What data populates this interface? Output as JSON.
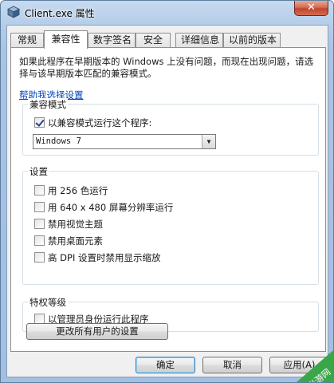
{
  "window": {
    "title": "Client.exe 属性",
    "close_label": "✕"
  },
  "tabs": [
    {
      "label": "常规"
    },
    {
      "label": "兼容性"
    },
    {
      "label": "数字签名"
    },
    {
      "label": "安全"
    },
    {
      "label": "详细信息"
    },
    {
      "label": "以前的版本"
    }
  ],
  "active_tab": "兼容性",
  "intro_text": "如果此程序在早期版本的 Windows 上没有问题，而现在出现问题，请选择与该早期版本匹配的兼容模式。",
  "help_link": "帮助我选择设置",
  "compat_mode": {
    "title": "兼容模式",
    "checkbox_label": "以兼容模式运行这个程序:",
    "checked": true,
    "selected_os": "Windows 7"
  },
  "settings": {
    "title": "设置",
    "options": [
      {
        "label": "用 256 色运行",
        "checked": false
      },
      {
        "label": "用 640 x 480 屏幕分辨率运行",
        "checked": false
      },
      {
        "label": "禁用视觉主题",
        "checked": false
      },
      {
        "label": "禁用桌面元素",
        "checked": false
      },
      {
        "label": "高 DPI 设置时禁用显示缩放",
        "checked": false
      }
    ]
  },
  "privilege": {
    "title": "特权等级",
    "checkbox_label": "以管理员身份运行此程序",
    "checked": false
  },
  "change_all_button": "更改所有用户的设置",
  "buttons": {
    "ok": "确定",
    "cancel": "取消",
    "apply": "应用(A)"
  },
  "watermark_text": "当游网"
}
